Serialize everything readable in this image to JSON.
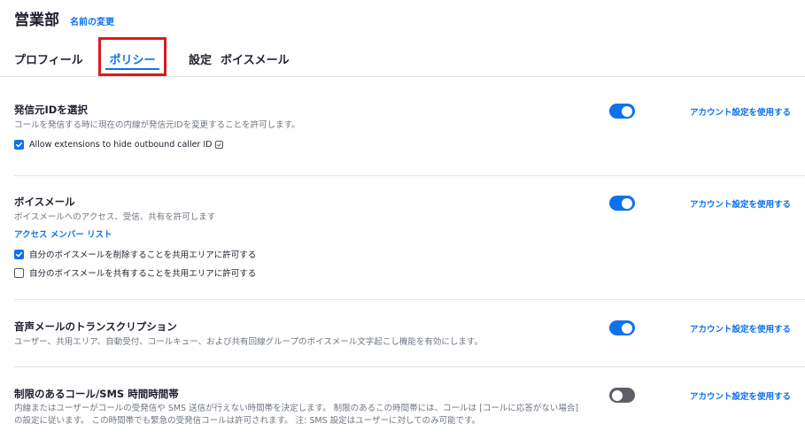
{
  "header": {
    "title": "営業部",
    "rename_label": "名前の変更"
  },
  "tabs": [
    {
      "label": "プロフィール",
      "active": false
    },
    {
      "label": "ポリシー",
      "active": true
    },
    {
      "label": "設定",
      "active": false
    },
    {
      "label": "ボイスメール",
      "active": false
    }
  ],
  "sections": {
    "caller_id": {
      "title": "発信元IDを選択",
      "description": "コールを発信する時に現在の内線が発信元IDを変更することを許可します。",
      "checkbox_label": "Allow extensions to hide outbound caller ID",
      "checkbox_checked": true,
      "checkbox_icon": "info-icon",
      "toggle_on": true,
      "account_link": "アカウント設定を使用する"
    },
    "voicemail": {
      "title": "ボイスメール",
      "description": "ボイスメールへのアクセス、受信、共有を許可します",
      "access_link": "アクセス メンバー リスト",
      "checkbox1_label": "自分のボイスメールを削除することを共用エリアに許可する",
      "checkbox1_checked": true,
      "checkbox2_label": "自分のボイスメールを共有することを共用エリアに許可する",
      "checkbox2_checked": false,
      "toggle_on": true,
      "account_link": "アカウント設定を使用する"
    },
    "transcription": {
      "title": "音声メールのトランスクリプション",
      "description": "ユーザー、共用エリア、自動受付、コールキュー、および共有回線グループのボイスメール文字起こし機能を有効にします。",
      "toggle_on": true,
      "account_link": "アカウント設定を使用する"
    },
    "restricted": {
      "title": "制限のあるコール/SMS 時間時間帯",
      "description_line1": "内線またはユーザーがコールの受発信や SMS 送信が行えない時間帯を決定します。 制限のあるこの時間帯には、コールは [コールに応答がない場合]",
      "description_line2": "の設定に従います。 この時間帯でも緊急の受発信コールは許可されます。 注: SMS 設定はユーザーに対してのみ可能です。",
      "toggle_on": false,
      "account_link": "アカウント設定を使用する"
    }
  },
  "colors": {
    "accent": "#0e72ed",
    "highlight_box": "#e01a1a",
    "toggle_off": "#5e5f66"
  }
}
